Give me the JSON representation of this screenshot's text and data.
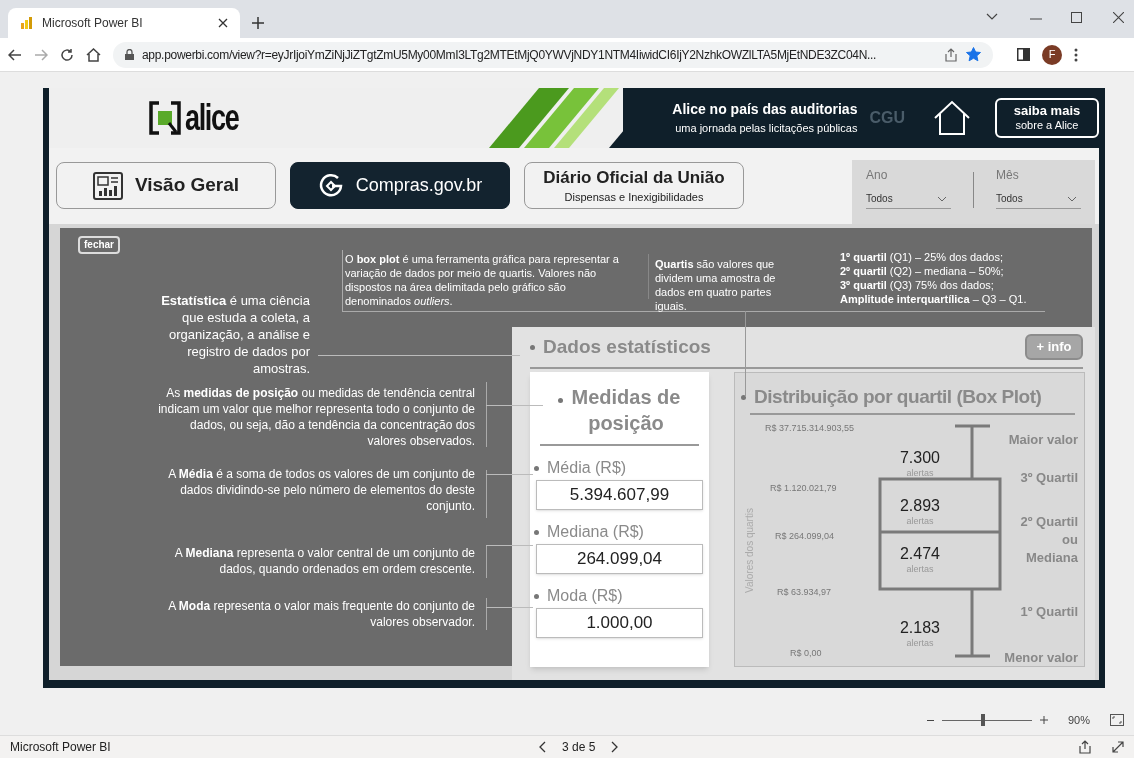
{
  "browser": {
    "tab_title": "Microsoft Power BI",
    "url": "app.powerbi.com/view?r=eyJrIjoiYmZiNjJiZTgtZmU5My00MmI3LTg2MTEtMjQ0YWVjNDY1NTM4IiwidCI6IjY2NzhkOWZlLTA5MjEtNDE3ZC04N...",
    "profile_initial": "F",
    "bookmarked": true
  },
  "header": {
    "logo_text": "alice",
    "title": "Alice no país das auditorias",
    "subtitle": "uma jornada pelas licitações públicas",
    "faint_mark": "CGU",
    "about_button": {
      "label": "saiba mais",
      "sublabel": "sobre a Alice"
    }
  },
  "nav": [
    {
      "kind": "icon",
      "label": "Visão Geral",
      "selected": false
    },
    {
      "kind": "brand",
      "label": "Compras.gov.br",
      "selected": true
    },
    {
      "kind": "subtitle",
      "label": "Diário Oficial da União",
      "sublabel": "Dispensas e Inexigibilidades",
      "selected": false
    }
  ],
  "filters": [
    {
      "label": "Ano",
      "value": "Todos"
    },
    {
      "label": "Mês",
      "value": "Todos"
    }
  ],
  "overlay": {
    "close_label": "fechar",
    "side_notes": [
      "**Estatística** é uma ciência que estuda a coleta, a organização, a análise e registro de dados por amostras.",
      "As **medidas de posição** ou medidas de tendência central indicam um valor que melhor representa todo o conjunto de dados, ou seja, dão a tendência da concentração dos valores observados.",
      "A **Média** é a soma de todos os valores de um conjunto de dados dividindo-se pelo número de elementos do deste conjunto.",
      "A **Mediana** representa o valor central de um conjunto de dados, quando ordenados em ordem crescente.",
      "A **Moda** representa o valor mais frequente do conjunto de valores observador."
    ],
    "top_notes": [
      "O **box plot** é uma ferramenta gráfica para representar a variação de dados por meio de quartis. Valores não dispostos na área delimitada pelo gráfico são denominados *outliers*.",
      "**Quartis** são valores que dividem uma amostra de dados em quatro partes iguais."
    ],
    "quartile_notes": [
      "**1º quartil** (Q1) – 25%  dos dados;",
      "**2º quartil** (Q2) – mediana – 50%;",
      "**3º quartil** (Q3) 75% dos dados;",
      "**Amplitude interquartílica** – Q3 – Q1."
    ]
  },
  "stats": {
    "title": "Dados estatísticos",
    "info_button": "+ info",
    "measures": {
      "title": "Medidas de posição",
      "items": [
        {
          "label": "Média (R$)",
          "value": "5.394.607,99"
        },
        {
          "label": "Mediana (R$)",
          "value": "264.099,04"
        },
        {
          "label": "Moda (R$)",
          "value": "1.000,00"
        }
      ]
    },
    "boxplot": {
      "title": "Distribuição por quartil (Box Plot)",
      "axis_label": "Valores dos quartis",
      "value_labels": [
        "R$ 37.715.314.903,55",
        "R$ 1.120.021,79",
        "R$ 264.099,04",
        "R$ 63.934,97",
        "R$ 0,00"
      ],
      "counts": [
        {
          "value": "7.300",
          "unit": "alertas"
        },
        {
          "value": "2.893",
          "unit": "alertas"
        },
        {
          "value": "2.474",
          "unit": "alertas"
        },
        {
          "value": "2.183",
          "unit": "alertas"
        }
      ],
      "quartile_labels": [
        "Maior valor",
        "3º Quartil",
        "2º Quartil ou Mediana",
        "1º Quartil",
        "Menor valor"
      ]
    }
  },
  "zoom": {
    "level": 0.45,
    "percent": "90%"
  },
  "status_bar": {
    "app_name": "Microsoft Power BI",
    "page_indicator": "3 de 5"
  }
}
